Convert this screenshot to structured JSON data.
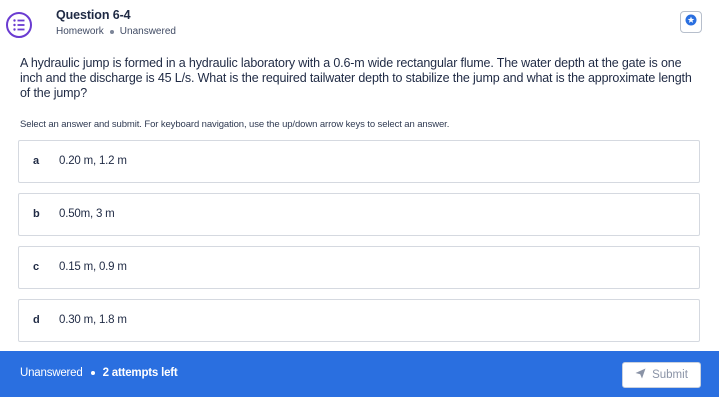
{
  "header": {
    "title": "Question 6-4",
    "category": "Homework",
    "status": "Unanswered",
    "icon": "question-list-icon",
    "bookmark_icon": "bookmark-icon"
  },
  "question": {
    "text": "A hydraulic jump is formed in a hydraulic laboratory with a 0.6-m wide rectangular flume. The water depth at the gate is one inch and the discharge is 45 L/s. What is the required tailwater depth to stabilize the jump and what is the approximate length of the jump?",
    "instructions": "Select an answer and submit. For keyboard navigation, use the up/down arrow keys to select an answer."
  },
  "options": [
    {
      "letter": "a",
      "text": "0.20 m, 1.2 m"
    },
    {
      "letter": "b",
      "text": "0.50m, 3 m"
    },
    {
      "letter": "c",
      "text": "0.15 m, 0.9 m"
    },
    {
      "letter": "d",
      "text": "0.30 m, 1.8 m"
    }
  ],
  "footer": {
    "status": "Unanswered",
    "attempts": "2 attempts left",
    "submit_label": "Submit",
    "submit_icon": "send-icon"
  },
  "colors": {
    "accent": "#2a6fe0",
    "icon_purple": "#6a3bd1"
  }
}
